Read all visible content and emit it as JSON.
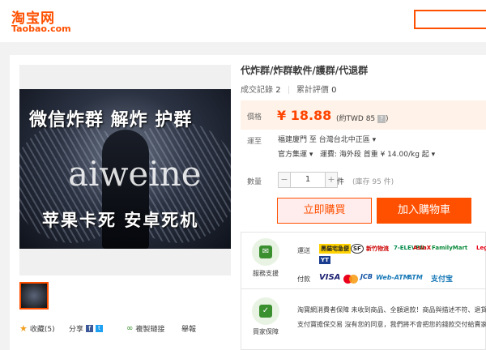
{
  "header": {
    "logo_cn": "淘宝网",
    "logo_en": "Taobao.com"
  },
  "product": {
    "title": "代炸群/炸群軟件/護群/代退群",
    "image_text_top": "微信炸群 解炸 护群",
    "image_watermark": "aiweine",
    "image_text_bottom": "苹果卡死 安卓死机",
    "sales_label": "成交記錄",
    "sales_count": "2",
    "reviews_label": "累計評價",
    "reviews_count": "0"
  },
  "price": {
    "label": "價格",
    "value": "¥ 18.88",
    "twd": "(約TWD 85",
    "twd_close": ")",
    "help_icon": "?"
  },
  "shipping": {
    "label": "運至",
    "destination": "福建廈門 至  台灣台北中正區 ▾",
    "method": "官方集運 ▾",
    "detail": "運費: 海外段 首重 ¥ 14.00/kg 起 ▾"
  },
  "quantity": {
    "label": "數量",
    "minus": "−",
    "value": "1",
    "plus": "+",
    "unit": "件",
    "stock": "(庫存 95 件)"
  },
  "buttons": {
    "buy_now": "立即購買",
    "add_to_cart": "加入購物車"
  },
  "actions": {
    "favorite": "收藏(5)",
    "share": "分享",
    "copy_link": "複製鏈接",
    "report": "舉報"
  },
  "service": {
    "support_caption": "服務支援",
    "delivery_label": "運送",
    "delivery_logos": [
      "黑貓宅急便",
      "SF",
      "新竹物流",
      "7-ELEVEN",
      "AsiaX",
      "FamilyMart",
      "Leg",
      "YT"
    ],
    "payment_label": "付款",
    "payment_logos": [
      "VISA",
      "JCB",
      "Web-ATM",
      "ATM",
      "支付宝"
    ],
    "protection_caption": "買家保障",
    "protection_line1": "淘寶網消費者保障   未收到商品、全額退款！商品與描述不符、退貨",
    "protection_line2": "支付寶擔保交易       沒有您的同意，我們將不會把您的錢款交付給賣家"
  },
  "colors": {
    "accent": "#ff5000",
    "price": "#ff4400",
    "price_bg": "#fff2e8",
    "service_green": "#3a8f2f"
  }
}
